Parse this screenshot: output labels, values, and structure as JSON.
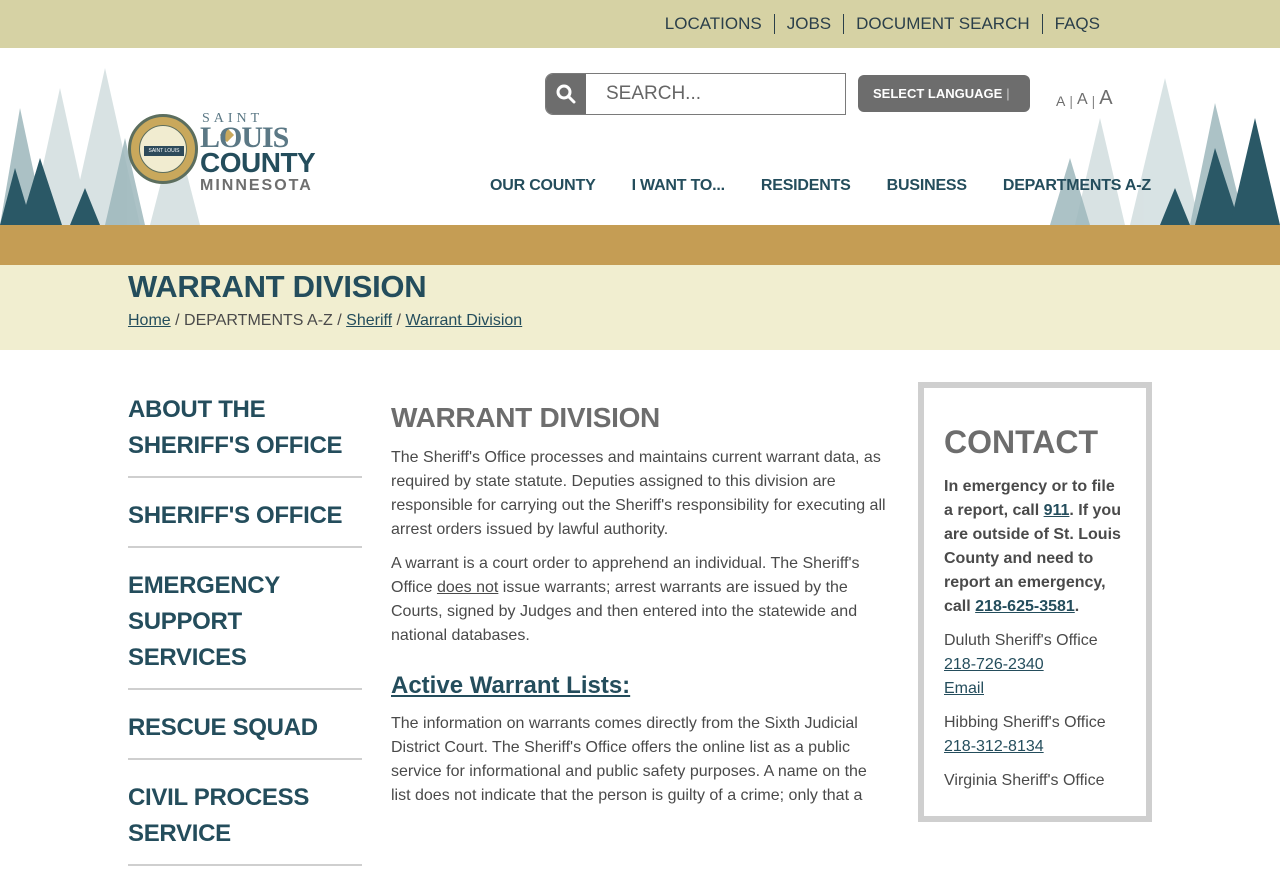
{
  "utility_nav": [
    "LOCATIONS",
    "JOBS",
    "DOCUMENT SEARCH",
    "FAQS"
  ],
  "logo": {
    "saint": "SAINT",
    "louis": "LOUIS",
    "county": "COUNTY",
    "state": "MINNESOTA",
    "seal_text": "SAINT LOUIS"
  },
  "search": {
    "placeholder": "SEARCH..."
  },
  "language": {
    "label": "SELECT LANGUAGE",
    "separator": "|"
  },
  "font_size": {
    "small": "A",
    "medium": "A",
    "large": "A",
    "sep": "|"
  },
  "main_nav": [
    "OUR COUNTY",
    "I WANT TO...",
    "RESIDENTS",
    "BUSINESS",
    "DEPARTMENTS A-Z"
  ],
  "page": {
    "title": "WARRANT DIVISION",
    "breadcrumb": {
      "home": "Home",
      "sep": " / ",
      "departments": "DEPARTMENTS A-Z",
      "sheriff": "Sheriff",
      "current": "Warrant Division"
    }
  },
  "side_nav": [
    "ABOUT THE SHERIFF'S OFFICE",
    "SHERIFF'S OFFICE",
    "EMERGENCY SUPPORT SERVICES",
    "RESCUE SQUAD",
    "CIVIL PROCESS SERVICE"
  ],
  "content": {
    "heading": "WARRANT DIVISION",
    "para1": "The Sheriff's Office processes and maintains current warrant data, as required by state statute. Deputies assigned to this division are responsible for carrying out the Sheriff's responsibility for executing all arrest orders issued by lawful authority.",
    "para2_before": "A warrant is a court order to apprehend an individual. The Sheriff's Office ",
    "para2_underline": "does not",
    "para2_after": " issue warrants; arrest warrants are issued by the Courts, signed by Judges and then entered into the statewide and national databases.",
    "subheading": "Active Warrant Lists:",
    "para3": "The information on warrants comes directly from the Sixth Judicial District Court. The Sheriff's Office offers the online list as a public service for informational and public safety purposes. A name on the list does not indicate that the person is guilty of a crime; only that a"
  },
  "contact": {
    "heading": "CONTACT",
    "emergency_1": "In emergency or to file a report, call ",
    "emergency_911": "911",
    "emergency_2": ". If you are outside of St. Louis County and need to report an emergency, call ",
    "emergency_phone": "218-625-3581",
    "emergency_3": ".",
    "offices": [
      {
        "name": "Duluth Sheriff's Office",
        "phone": "218-726-2340",
        "email": "Email"
      },
      {
        "name": "Hibbing Sheriff's Office",
        "phone": "218-312-8134"
      },
      {
        "name": "Virginia Sheriff's Office"
      }
    ]
  },
  "colors": {
    "utility_bar": "#d6d2a4",
    "gold_band": "#c59d54",
    "title_bg": "#f1eed0",
    "navy": "#244d5c",
    "gray": "#6d6d6d"
  }
}
